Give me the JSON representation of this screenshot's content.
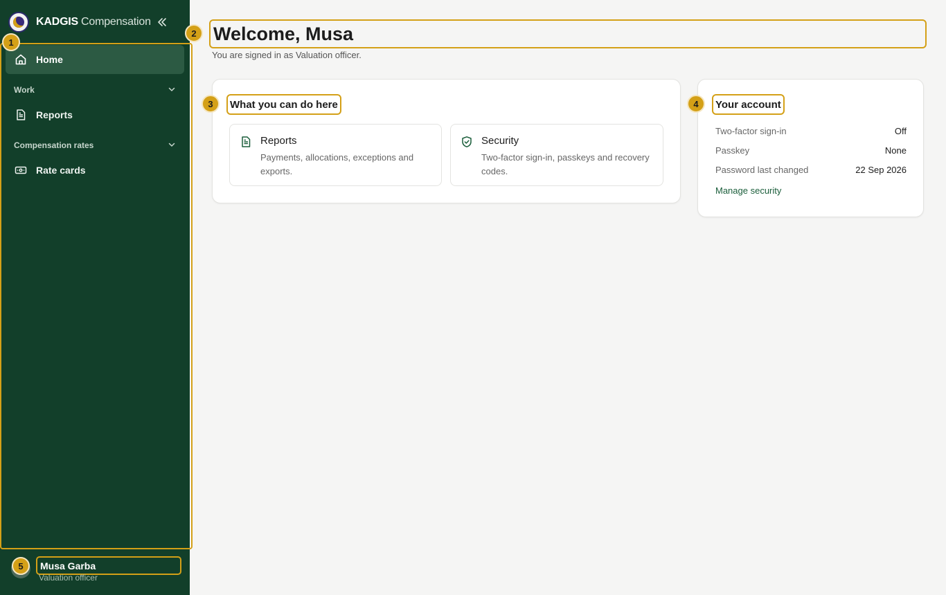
{
  "brand": {
    "name": "KADGIS",
    "subtitle": "Compensation"
  },
  "sidebar": {
    "home_label": "Home",
    "sections": [
      {
        "label": "Work",
        "items": [
          {
            "label": "Reports"
          }
        ]
      },
      {
        "label": "Compensation rates",
        "items": [
          {
            "label": "Rate cards"
          }
        ]
      }
    ]
  },
  "user": {
    "name": "Musa Garba",
    "role": "Valuation officer"
  },
  "main": {
    "title": "Welcome, Musa",
    "subtitle": "You are signed in as Valuation officer."
  },
  "actions_card": {
    "title": "What you can do here",
    "tiles": [
      {
        "title": "Reports",
        "description": "Payments, allocations, exceptions and exports."
      },
      {
        "title": "Security",
        "description": "Two-factor sign-in, passkeys and recovery codes."
      }
    ]
  },
  "account_card": {
    "title": "Your account",
    "rows": [
      {
        "key": "Two-factor sign-in",
        "value": "Off"
      },
      {
        "key": "Passkey",
        "value": "None"
      },
      {
        "key": "Password last changed",
        "value": "22 Sep 2026"
      }
    ],
    "link": "Manage security"
  },
  "markers": [
    "1",
    "2",
    "3",
    "4",
    "5"
  ],
  "colors": {
    "sidebar": "#123f2a",
    "accent": "#d4a017",
    "link": "#1b5e3b"
  }
}
